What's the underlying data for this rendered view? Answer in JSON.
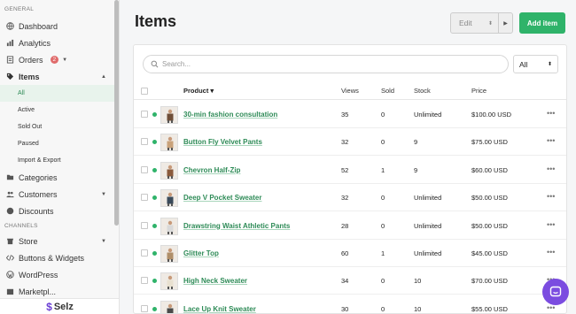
{
  "sidebar": {
    "section_general": "GENERAL",
    "section_channels": "CHANNELS",
    "dashboard": "Dashboard",
    "analytics": "Analytics",
    "orders": "Orders",
    "orders_badge": "2",
    "items": "Items",
    "sub_all": "All",
    "sub_active": "Active",
    "sub_sold_out": "Sold Out",
    "sub_paused": "Paused",
    "sub_import_export": "Import & Export",
    "categories": "Categories",
    "customers": "Customers",
    "discounts": "Discounts",
    "store": "Store",
    "buttons_widgets": "Buttons & Widgets",
    "wordpress": "WordPress",
    "truncated": "Marketpl...",
    "logo": "Selz"
  },
  "header": {
    "title": "Items",
    "edit_label": "Edit",
    "add_label": "Add item"
  },
  "toolbar": {
    "search_placeholder": "Search...",
    "filter_value": "All"
  },
  "table": {
    "columns": {
      "product": "Product",
      "views": "Views",
      "sold": "Sold",
      "stock": "Stock",
      "price": "Price"
    },
    "rows": [
      {
        "name": "30-min fashion consultation",
        "views": "35",
        "sold": "0",
        "stock": "Unlimited",
        "price": "$100.00 USD"
      },
      {
        "name": "Button Fly Velvet Pants",
        "views": "32",
        "sold": "0",
        "stock": "9",
        "price": "$75.00 USD"
      },
      {
        "name": "Chevron Half-Zip",
        "views": "52",
        "sold": "1",
        "stock": "9",
        "price": "$60.00 USD"
      },
      {
        "name": "Deep V Pocket Sweater",
        "views": "32",
        "sold": "0",
        "stock": "Unlimited",
        "price": "$50.00 USD"
      },
      {
        "name": "Drawstring Waist Athletic Pants",
        "views": "28",
        "sold": "0",
        "stock": "Unlimited",
        "price": "$50.00 USD"
      },
      {
        "name": "Glitter Top",
        "views": "60",
        "sold": "1",
        "stock": "Unlimited",
        "price": "$45.00 USD"
      },
      {
        "name": "High Neck Sweater",
        "views": "34",
        "sold": "0",
        "stock": "10",
        "price": "$70.00 USD"
      },
      {
        "name": "Lace Up Knit Sweater",
        "views": "30",
        "sold": "0",
        "stock": "10",
        "price": "$55.00 USD"
      }
    ]
  },
  "colors": {
    "accent": "#2fb36a",
    "link": "#2e8b57",
    "brand": "#7b4ce0",
    "badge": "#e06b6b"
  }
}
